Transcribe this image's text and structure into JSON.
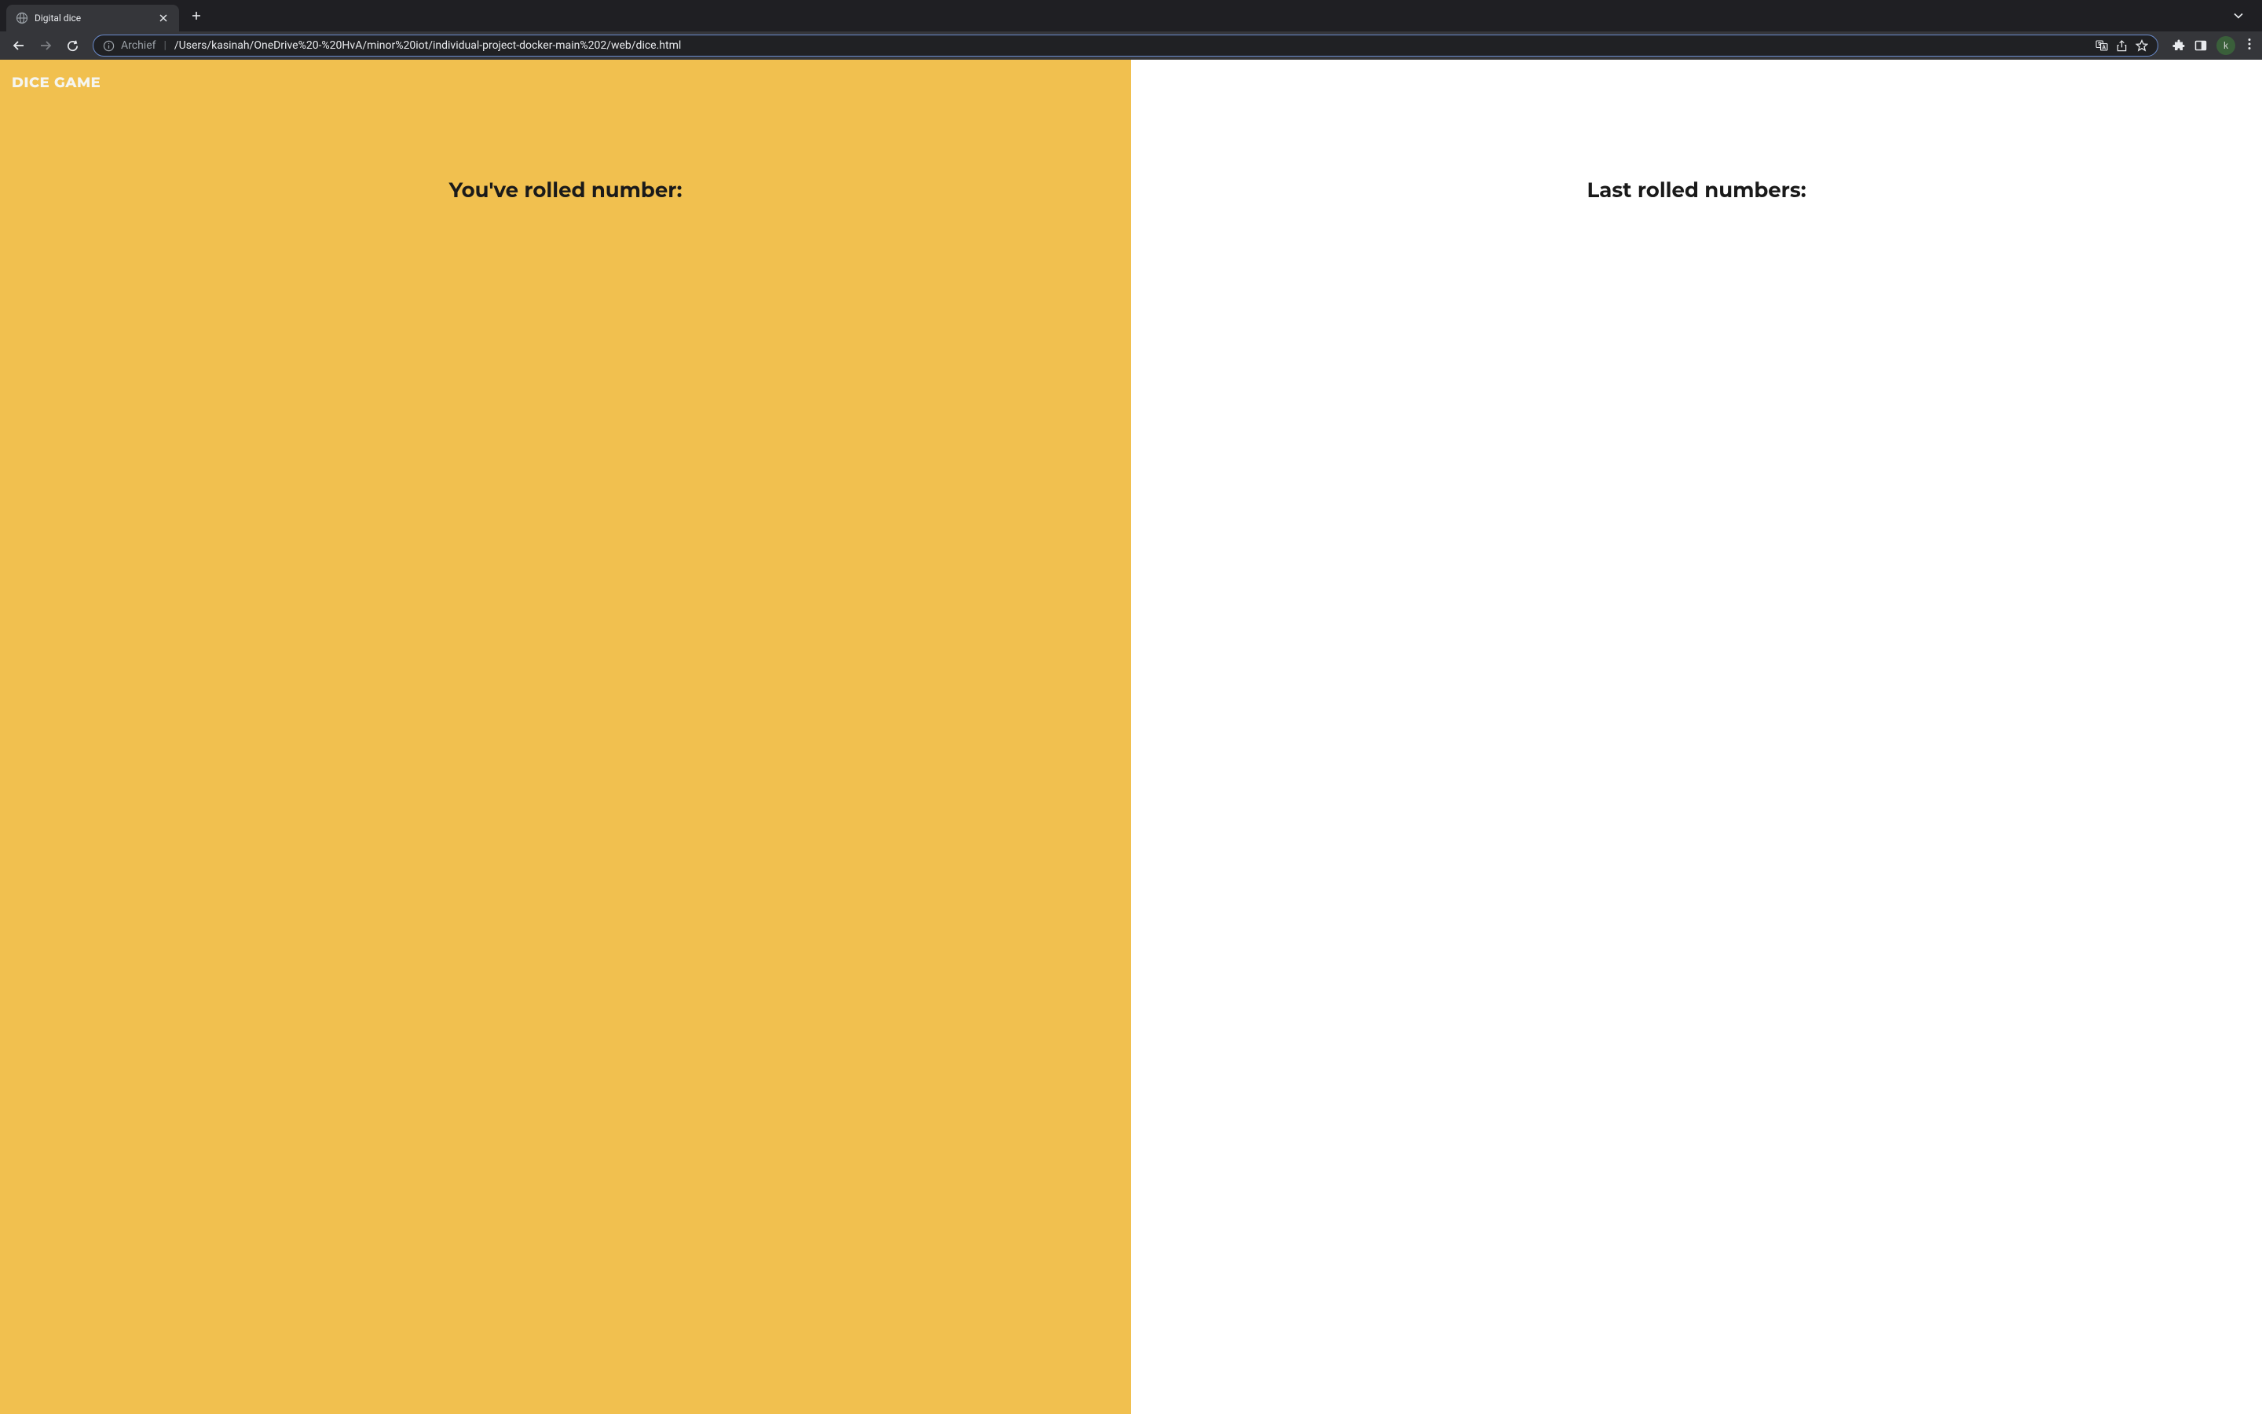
{
  "browser": {
    "tab": {
      "title": "Digital dice"
    },
    "url": {
      "prefix": "Archief",
      "path": "/Users/kasinah/OneDrive%20-%20HvA/minor%20iot/individual-project-docker-main%202/web/dice.html"
    },
    "avatar_initial": "k"
  },
  "page": {
    "title": "DICE GAME",
    "left_heading": "You've rolled number:",
    "right_heading": "Last rolled numbers:"
  },
  "colors": {
    "accent_yellow": "#f1c04f",
    "chrome_dark": "#1f1f23",
    "tab_active": "#35363a"
  }
}
